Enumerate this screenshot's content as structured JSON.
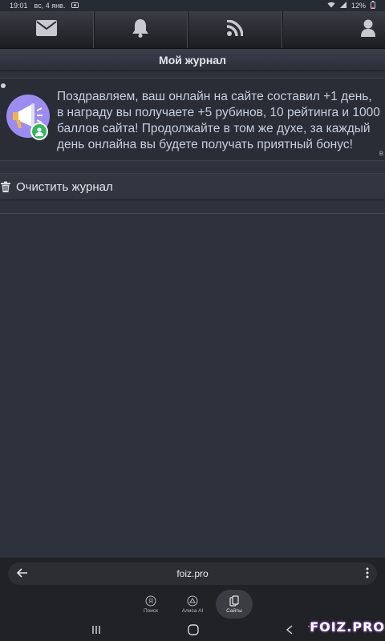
{
  "statusbar": {
    "time": "19:01",
    "date": "вс, 4 янв.",
    "battery": "12%"
  },
  "nav": [
    {
      "icon": "envelope-icon"
    },
    {
      "icon": "bell-icon"
    },
    {
      "icon": "rss-icon"
    },
    {
      "icon": "user-icon"
    }
  ],
  "page": {
    "title": "Мой журнал"
  },
  "notice": {
    "text": "Поздравляем, ваш онлайн на сайте составил +1 день, в награду вы получаете +5 рубинов, 10 рейтинга и 1000 баллов сайта! Продолжайте в том же духе, за каждый день онлайна вы будете получать приятный бонус!",
    "more_label": "в"
  },
  "actions": {
    "clear_label": "Очистить журнал"
  },
  "browser": {
    "url": "foiz.pro",
    "tabs": [
      {
        "label": "Поиск",
        "glyph": "Я"
      },
      {
        "label": "Алиса AI",
        "glyph": ""
      },
      {
        "label": "Сайты",
        "glyph": ""
      }
    ],
    "active_tab": 2
  },
  "watermark": {
    "text": "FOIZ.PRO"
  },
  "colors": {
    "accent": "#9d8cef",
    "badge": "#30b75f",
    "background": "#2e323d"
  }
}
